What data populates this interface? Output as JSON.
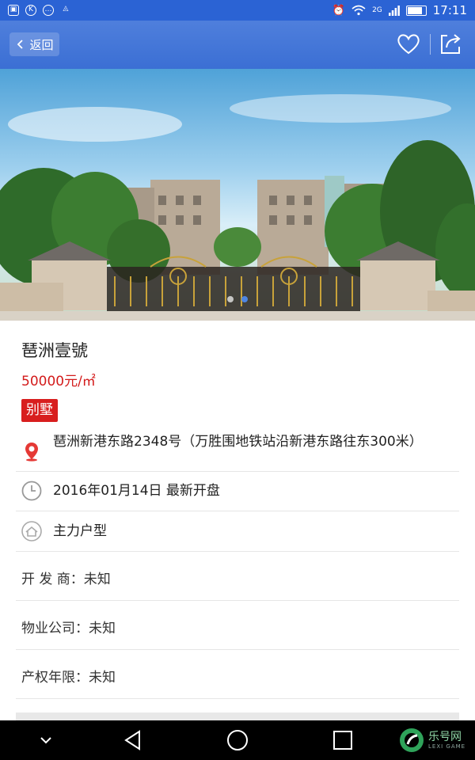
{
  "status_bar": {
    "time": "17:11",
    "network": "2G",
    "left_icons": [
      "gallery-icon",
      "k-app-icon",
      "chat-icon",
      "android-icon"
    ],
    "battery_level": 0.75
  },
  "header": {
    "back_label": "返回",
    "favorite_icon": "heart-icon",
    "share_icon": "share-icon",
    "accent_color": "#3b6fd4"
  },
  "hero": {
    "carousel_pages": 2,
    "active_page": 2
  },
  "property": {
    "name": "琶洲壹號",
    "price": "50000元/㎡",
    "tag": "别墅",
    "price_color": "#d31b1b"
  },
  "details": {
    "address": "琶洲新港东路2348号（万胜围地铁站沿新港东路往东300米）",
    "open_date": "2016年01月14日 最新开盘",
    "main_unit": "主力户型",
    "developer": "开 发 商：未知",
    "property_company": "物业公司：未知",
    "property_term": "产权年限：未知"
  },
  "nav_bar": {
    "buttons": [
      "hide-nav-icon",
      "back-triangle-icon",
      "home-circle-icon",
      "recents-square-icon"
    ]
  },
  "watermark": {
    "text": "乐号网",
    "sub": "LEXI GAME"
  }
}
